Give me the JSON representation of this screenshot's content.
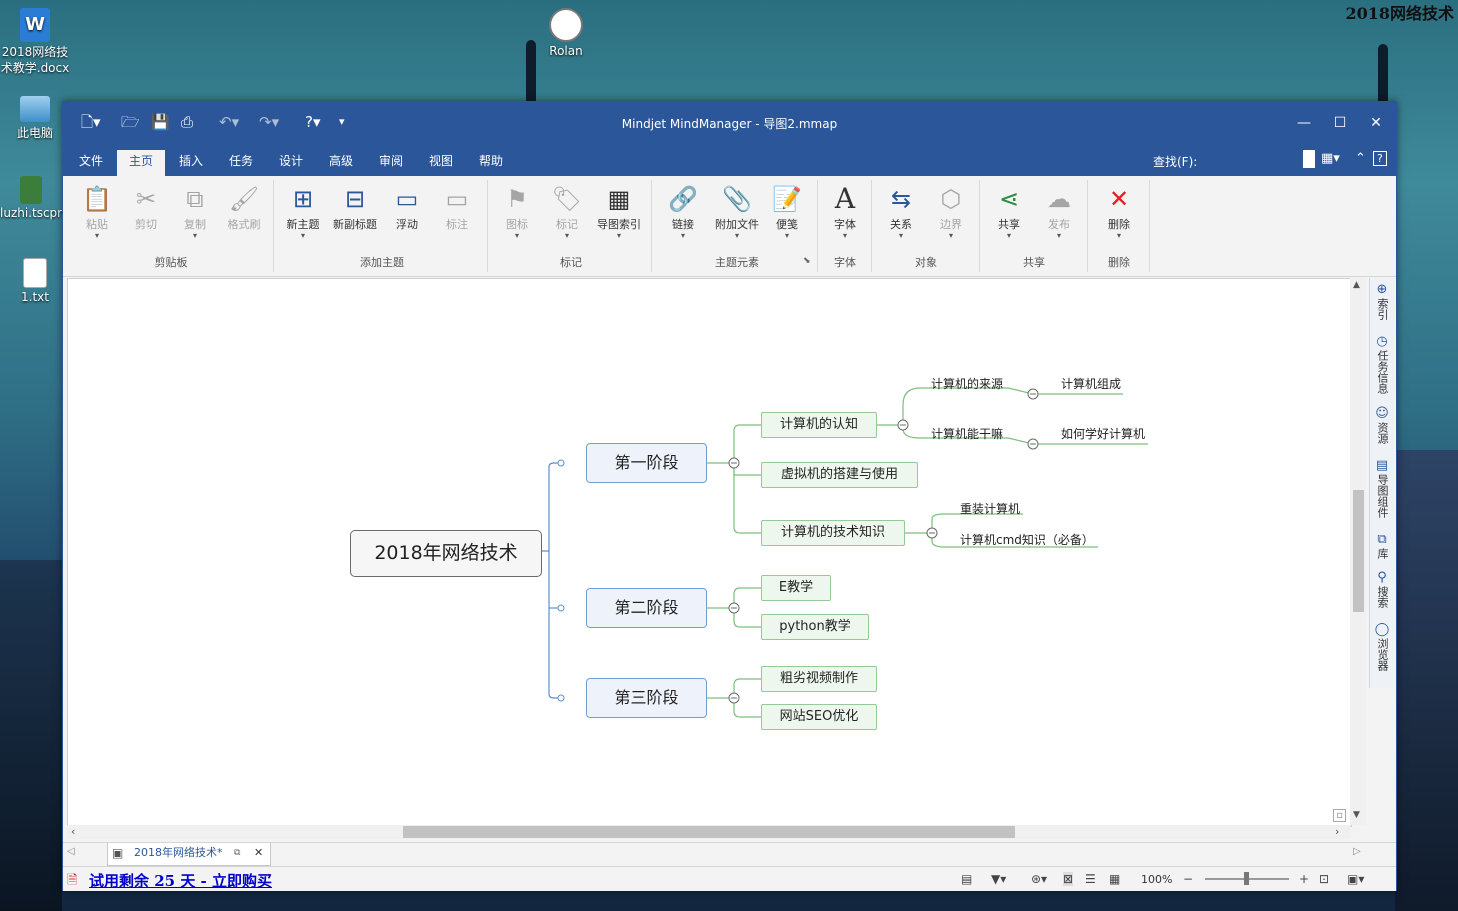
{
  "desktop": {
    "icons": [
      {
        "label": "2018网络技\n术教学.docx",
        "icon": "word-doc-icon"
      },
      {
        "label": "此电脑",
        "icon": "computer-icon"
      },
      {
        "label": "luzhi.tscpro",
        "icon": "camtasia-project-icon"
      },
      {
        "label": "1.txt",
        "icon": "text-file-icon"
      },
      {
        "label": "Rolan",
        "icon": "rolan-app-icon"
      }
    ],
    "corner_title": "2018网络技术"
  },
  "window": {
    "title": "Mindjet MindManager - 导图2.mmap",
    "controls": {
      "minimize": "—",
      "maximize": "☐",
      "close": "✕"
    }
  },
  "quick_access": [
    "new-file-icon",
    "open-icon",
    "save-icon",
    "print-icon",
    "undo-icon",
    "redo-icon",
    "help-icon",
    "customize-icon"
  ],
  "tabs": [
    "文件",
    "主页",
    "插入",
    "任务",
    "设计",
    "高级",
    "审阅",
    "视图",
    "帮助"
  ],
  "active_tab": "主页",
  "find": {
    "label": "查找(F):"
  },
  "ribbon": {
    "buttons": [
      {
        "label": "粘贴",
        "glyph": "📋",
        "enabled": false,
        "caret": true
      },
      {
        "label": "剪切",
        "glyph": "✂",
        "enabled": false,
        "caret": false
      },
      {
        "label": "复制",
        "glyph": "⧉",
        "enabled": false,
        "caret": true
      },
      {
        "label": "格式刷",
        "glyph": "🖌",
        "enabled": false,
        "caret": false
      },
      {
        "label": "新主题",
        "glyph": "⊞",
        "enabled": true,
        "caret": true
      },
      {
        "label": "新副标题",
        "glyph": "⊟",
        "enabled": true,
        "caret": false
      },
      {
        "label": "浮动",
        "glyph": "▭",
        "enabled": true,
        "caret": false
      },
      {
        "label": "标注",
        "glyph": "▭",
        "enabled": false,
        "caret": false
      },
      {
        "label": "图标",
        "glyph": "⚑",
        "enabled": false,
        "caret": true
      },
      {
        "label": "标记",
        "glyph": "🏷",
        "enabled": false,
        "caret": true
      },
      {
        "label": "导图索引",
        "glyph": "▦",
        "enabled": true,
        "caret": true
      },
      {
        "label": "链接",
        "glyph": "🔗",
        "enabled": true,
        "caret": true
      },
      {
        "label": "附加文件",
        "glyph": "📎",
        "enabled": true,
        "caret": true
      },
      {
        "label": "便笺",
        "glyph": "📝",
        "enabled": true,
        "caret": true
      },
      {
        "label": "字体",
        "glyph": "A",
        "enabled": true,
        "caret": true
      },
      {
        "label": "关系",
        "glyph": "⇆",
        "enabled": true,
        "caret": true
      },
      {
        "label": "边界",
        "glyph": "⬡",
        "enabled": false,
        "caret": true
      },
      {
        "label": "共享",
        "glyph": "⋖",
        "enabled": true,
        "caret": true
      },
      {
        "label": "发布",
        "glyph": "☁",
        "enabled": false,
        "caret": true
      },
      {
        "label": "删除",
        "glyph": "✕",
        "enabled": true,
        "caret": true
      }
    ],
    "groups": [
      "剪贴板",
      "添加主题",
      "标记",
      "主题元素",
      "字体",
      "对象",
      "共享",
      "删除"
    ]
  },
  "side_panel": [
    "索引",
    "任务信息",
    "资源",
    "导图组件",
    "库",
    "搜索",
    "浏览器"
  ],
  "mindmap": {
    "central": "2018年网络技术",
    "branches": [
      {
        "label": "第一阶段",
        "children": [
          {
            "label": "计算机的认知",
            "children": [
              {
                "label": "计算机的来源",
                "children": [
                  "计算机组成"
                ]
              },
              {
                "label": "计算机能干嘛",
                "children": [
                  "如何学好计算机"
                ]
              }
            ]
          },
          {
            "label": "虚拟机的搭建与使用"
          },
          {
            "label": "计算机的技术知识",
            "children": [
              {
                "label": "重装计算机"
              },
              {
                "label": "计算机cmd知识（必备）"
              }
            ]
          }
        ]
      },
      {
        "label": "第二阶段",
        "children": [
          {
            "label": "E教学"
          },
          {
            "label": "python教学"
          }
        ]
      },
      {
        "label": "第三阶段",
        "children": [
          {
            "label": "粗劣视频制作"
          },
          {
            "label": "网站SEO优化"
          }
        ]
      }
    ]
  },
  "doc_tab": {
    "label": "2018年网络技术*"
  },
  "status": {
    "trial": "试用剩余 25 天 - 立即购买",
    "zoom": "100%"
  }
}
